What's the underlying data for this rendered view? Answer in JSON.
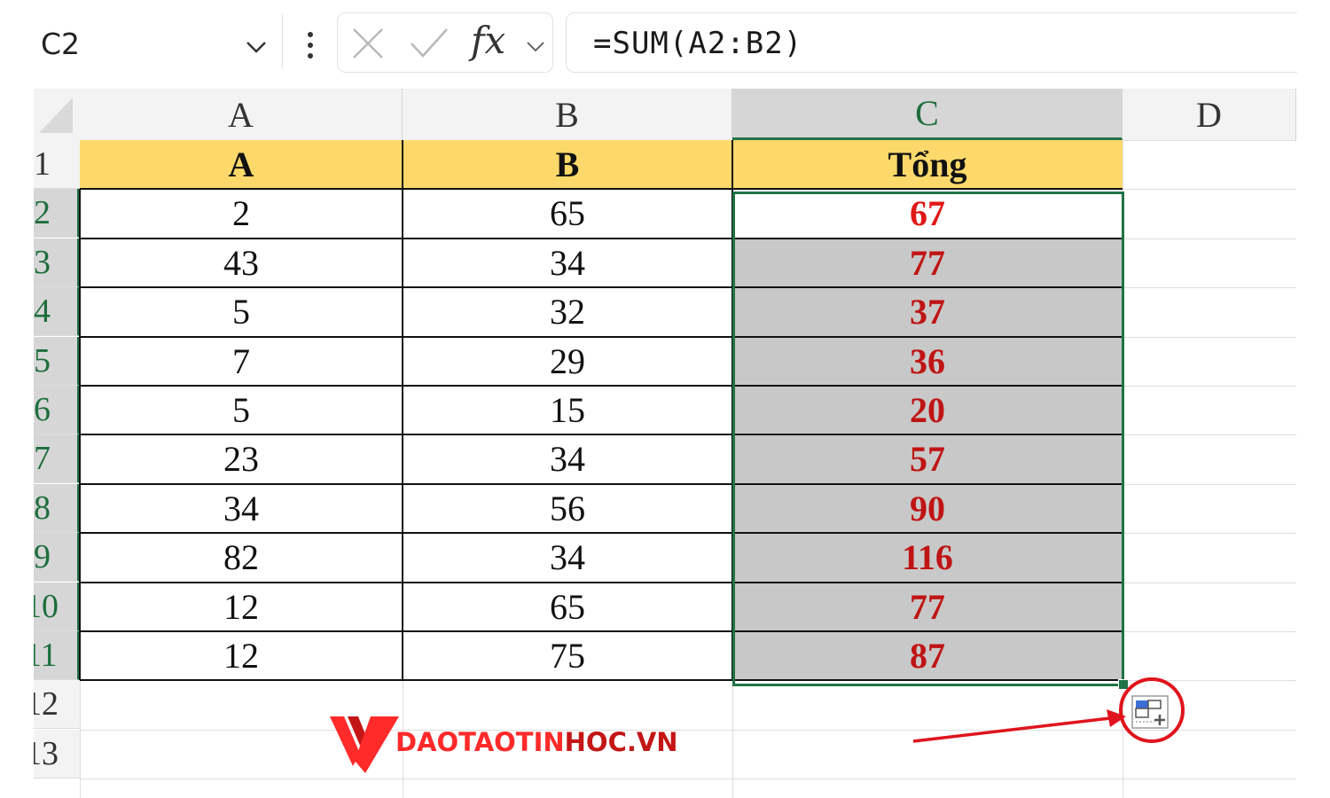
{
  "formula_bar": {
    "name_box": "C2",
    "formula": "=SUM(A2:B2)",
    "fx_label": "fx"
  },
  "columns": [
    "A",
    "B",
    "C",
    "D"
  ],
  "selected_column": "C",
  "rows": [
    "1",
    "2",
    "3",
    "4",
    "5",
    "6",
    "7",
    "8",
    "9",
    "10",
    "11",
    "12",
    "13"
  ],
  "table": {
    "headers": [
      "A",
      "B",
      "Tổng"
    ],
    "data": [
      [
        "2",
        "65",
        "67"
      ],
      [
        "43",
        "34",
        "77"
      ],
      [
        "5",
        "32",
        "37"
      ],
      [
        "7",
        "29",
        "36"
      ],
      [
        "5",
        "15",
        "20"
      ],
      [
        "23",
        "34",
        "57"
      ],
      [
        "34",
        "56",
        "90"
      ],
      [
        "82",
        "34",
        "116"
      ],
      [
        "12",
        "65",
        "77"
      ],
      [
        "12",
        "75",
        "87"
      ]
    ]
  },
  "logo": {
    "text_1": "DAOTAOTIN",
    "text_2": "HOC.VN"
  },
  "colors": {
    "header_fill": "#fdd96b",
    "selection_border": "#217346",
    "sum_text": "#e01818",
    "shaded_fill": "#c8c8c8",
    "annotation": "#e0141c"
  },
  "icons": {
    "name_box_dropdown": "chevron-down-icon",
    "more": "vertical-dots-icon",
    "cancel": "close-icon",
    "enter": "check-icon",
    "insert_function": "fx-icon",
    "quick_analysis": "quick-analysis-icon"
  }
}
